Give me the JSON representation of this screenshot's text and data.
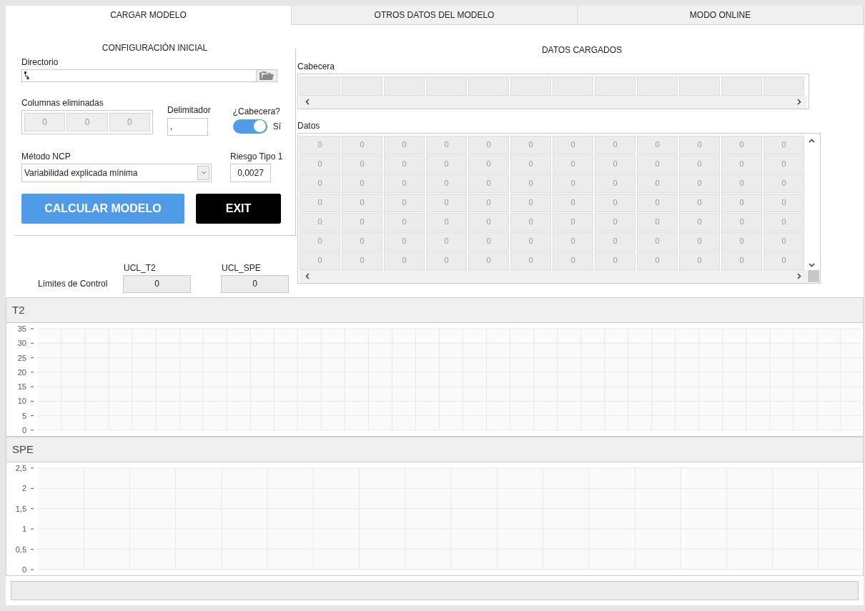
{
  "tabs": [
    {
      "label": "CARGAR MODELO",
      "selected": true
    },
    {
      "label": "OTROS DATOS DEL MODELO",
      "selected": false
    },
    {
      "label": "MODO ONLINE",
      "selected": false
    }
  ],
  "config": {
    "title": "CONFIGURACIÓN INICIAL",
    "directory": {
      "label": "Directorio"
    },
    "removed_columns": {
      "label": "Columnas eliminadas",
      "values": [
        "0",
        "0",
        "0"
      ]
    },
    "delimiter": {
      "label": "Delimitador",
      "value": ","
    },
    "header_toggle": {
      "label": "¿Cabecera?",
      "on": true,
      "state_text": "Sí"
    },
    "method": {
      "label": "Método NCP",
      "value": "Variabilidad explicada mínima"
    },
    "risk": {
      "label": "Riesgo Tipo 1",
      "value": "0,0027"
    },
    "buttons": [
      {
        "label": "CALCULAR MODELO",
        "kind": "primary"
      },
      {
        "label": "EXIT",
        "kind": "exit"
      }
    ]
  },
  "limits": {
    "label": "Límites de Control",
    "fields": [
      {
        "label": "UCL_T2",
        "value": "0"
      },
      {
        "label": "UCL_SPE",
        "value": "0"
      }
    ]
  },
  "loaded": {
    "title": "DATOS CARGADOS",
    "header_label": "Cabecera",
    "data_label": "Datos",
    "rows": [
      [
        "0",
        "0",
        "0",
        "0",
        "0",
        "0",
        "0",
        "0",
        "0",
        "0",
        "0",
        "0"
      ],
      [
        "0",
        "0",
        "0",
        "0",
        "0",
        "0",
        "0",
        "0",
        "0",
        "0",
        "0",
        "0"
      ],
      [
        "0",
        "0",
        "0",
        "0",
        "0",
        "0",
        "0",
        "0",
        "0",
        "0",
        "0",
        "0"
      ],
      [
        "0",
        "0",
        "0",
        "0",
        "0",
        "0",
        "0",
        "0",
        "0",
        "0",
        "0",
        "0"
      ],
      [
        "0",
        "0",
        "0",
        "0",
        "0",
        "0",
        "0",
        "0",
        "0",
        "0",
        "0",
        "0"
      ],
      [
        "0",
        "0",
        "0",
        "0",
        "0",
        "0",
        "0",
        "0",
        "0",
        "0",
        "0",
        "0"
      ],
      [
        "0",
        "0",
        "0",
        "0",
        "0",
        "0",
        "0",
        "0",
        "0",
        "0",
        "0",
        "0"
      ]
    ]
  },
  "charts": [
    {
      "title": "T2",
      "chart_data": {
        "type": "line",
        "grid": true,
        "categories": [
          null,
          null,
          null,
          null,
          null,
          null,
          null,
          null,
          null,
          null,
          null,
          null,
          null,
          null,
          null,
          null,
          null,
          null,
          null,
          null,
          null,
          null,
          null,
          null,
          null,
          null,
          null,
          null,
          null,
          null,
          null,
          null,
          null,
          null,
          null
        ],
        "ylim": [
          0,
          35
        ],
        "yticks": [
          {
            "value": 0,
            "label": "0"
          },
          {
            "value": 5,
            "label": "5"
          },
          {
            "value": 10,
            "label": "10"
          },
          {
            "value": 15,
            "label": "15"
          },
          {
            "value": 20,
            "label": "20"
          },
          {
            "value": 25,
            "label": "25"
          },
          {
            "value": 30,
            "label": "30"
          },
          {
            "value": 35,
            "label": "35"
          }
        ]
      }
    },
    {
      "title": "SPE",
      "chart_data": {
        "type": "line",
        "grid": true,
        "categories": [
          null,
          null,
          null,
          null,
          null,
          null,
          null,
          null,
          null,
          null,
          null,
          null,
          null,
          null,
          null,
          null,
          null,
          null
        ],
        "ylim": [
          0,
          2.5
        ],
        "yticks": [
          {
            "value": 0,
            "label": "0"
          },
          {
            "value": 0.5,
            "label": "0,5"
          },
          {
            "value": 1,
            "label": "1"
          },
          {
            "value": 1.5,
            "label": "1,5"
          },
          {
            "value": 2,
            "label": "2"
          },
          {
            "value": 2.5,
            "label": "2,5"
          }
        ]
      }
    }
  ]
}
